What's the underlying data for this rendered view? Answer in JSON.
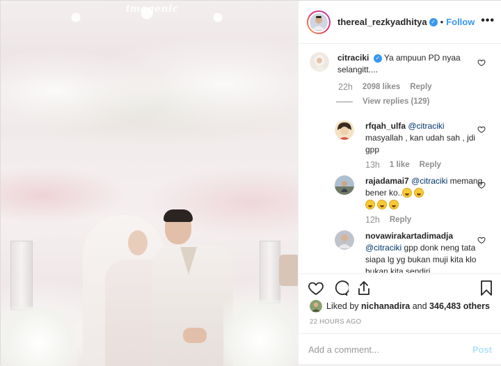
{
  "photo": {
    "watermark": "imagenic"
  },
  "header": {
    "username": "thereal_rezkyadhitya",
    "dot": "•",
    "follow_label": "Follow",
    "more_label": "•••"
  },
  "comments": [
    {
      "username": "citraciki",
      "text": "Ya ampuun PD nyaa selangitt....",
      "time": "22h",
      "likes": "2098 likes",
      "reply_label": "Reply",
      "view_replies": "View replies (129)"
    },
    {
      "username": "rfqah_ulfa",
      "mention": "@citraciki",
      "text": "masyallah , kan udah sah , jdi gpp",
      "time": "13h",
      "likes": "1 like",
      "reply_label": "Reply"
    },
    {
      "username": "rajadamai7",
      "mention": "@citraciki",
      "text": "memang bener ko..",
      "time": "12h",
      "reply_label": "Reply"
    },
    {
      "username": "novawirakartadimadja",
      "mention": "@citraciki",
      "text": "gpp donk neng tata siapa lg yg bukan muji kita klo bukan kita sendiri"
    }
  ],
  "likes_line": {
    "prefix": "Liked by",
    "user": "nichanadira",
    "middle": "and",
    "count": "346,483 others"
  },
  "timestamp": "22 HOURS AGO",
  "add_comment": {
    "placeholder": "Add a comment...",
    "post_label": "Post"
  },
  "colors": {
    "accent": "#3897f0",
    "post_disabled": "#b2dffc",
    "muted": "#8e8e8e"
  }
}
